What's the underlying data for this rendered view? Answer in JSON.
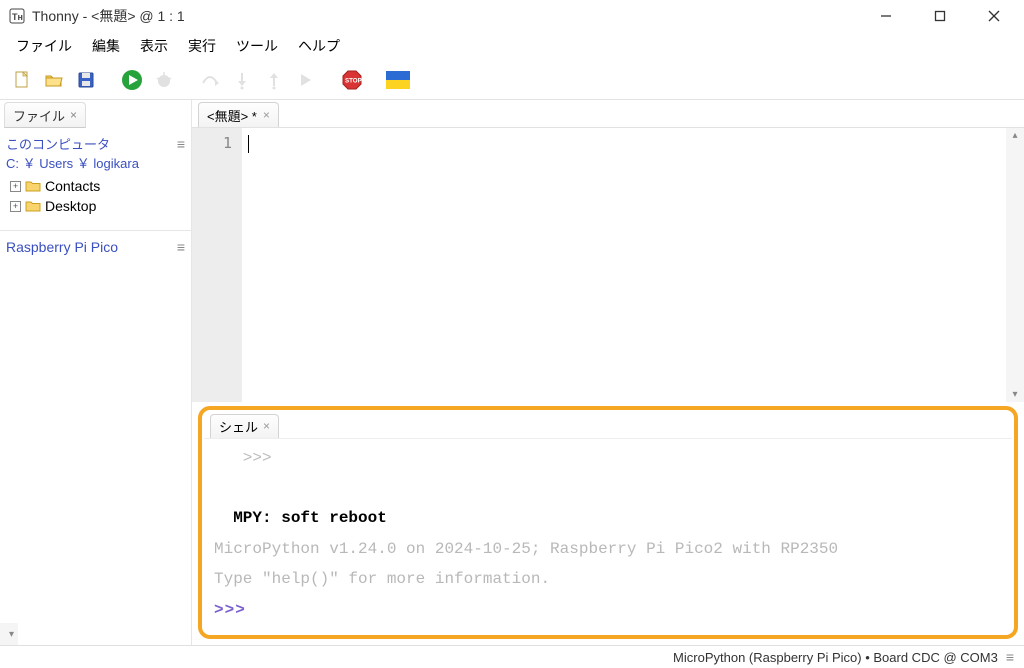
{
  "titlebar": {
    "title": "Thonny  -  <無題>  @  1 : 1"
  },
  "menubar": {
    "items": [
      {
        "label": "ファイル"
      },
      {
        "label": "編集"
      },
      {
        "label": "表示"
      },
      {
        "label": "実行"
      },
      {
        "label": "ツール"
      },
      {
        "label": "ヘルプ"
      }
    ]
  },
  "sidebar": {
    "tab_label": "ファイル",
    "computer_label": "このコンピュータ",
    "computer_path": "C: ￥ Users ￥ logikara",
    "tree": [
      {
        "label": "Contacts"
      },
      {
        "label": "Desktop"
      }
    ],
    "pico_label": "Raspberry Pi Pico"
  },
  "editor": {
    "tab_label": "<無題> *",
    "line_number": "1"
  },
  "shell": {
    "tab_label": "シェル",
    "lines": {
      "greyprompt": "   >>>",
      "line1": "  MPY: soft reboot",
      "line2": "MicroPython v1.24.0 on 2024-10-25; Raspberry Pi Pico2 with RP2350",
      "line3": "Type \"help()\" for more information.",
      "prompt": ">>> "
    }
  },
  "statusbar": {
    "text": "MicroPython (Raspberry Pi Pico)  •  Board CDC @ COM3"
  }
}
